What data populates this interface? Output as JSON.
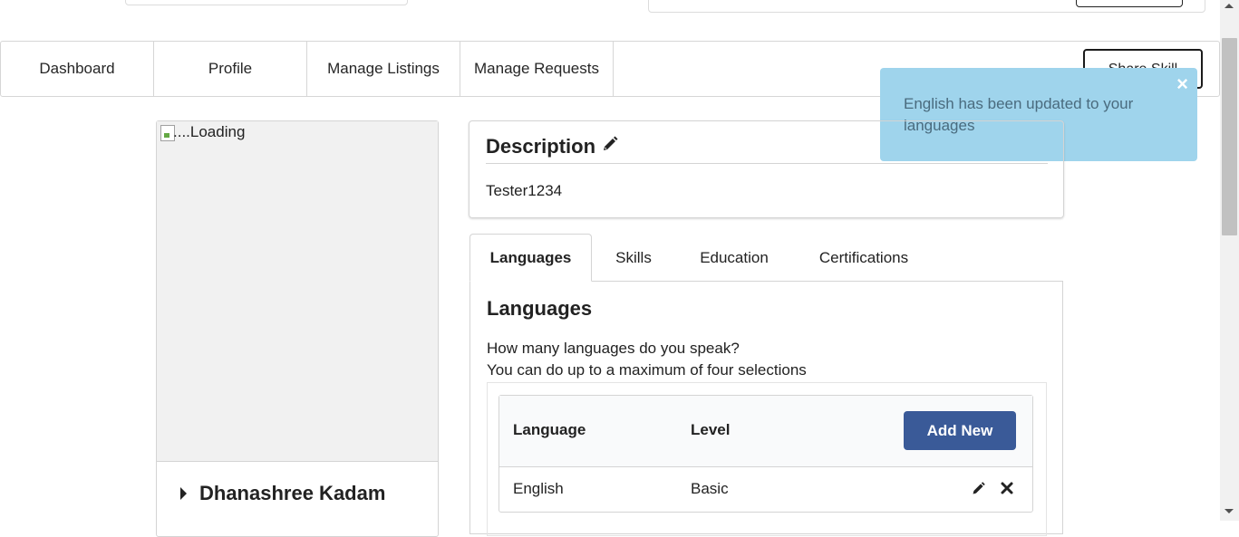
{
  "nav": {
    "items": [
      "Dashboard",
      "Profile",
      "Manage Listings",
      "Manage Requests"
    ],
    "share_label": "Share Skill"
  },
  "toast": {
    "message": "English has been updated to your languages",
    "close": "×"
  },
  "profile": {
    "image_alt": "....Loading",
    "name": "Dhanashree Kadam"
  },
  "description": {
    "title": "Description",
    "text": "Tester1234",
    "edit_icon": "pencil-icon"
  },
  "tabs": [
    "Languages",
    "Skills",
    "Education",
    "Certifications"
  ],
  "languages": {
    "title": "Languages",
    "help_line1": "How many languages do you speak?",
    "help_line2": "You can do up to a maximum of four selections",
    "columns": {
      "language": "Language",
      "level": "Level"
    },
    "add_label": "Add New",
    "rows": [
      {
        "language": "English",
        "level": "Basic"
      }
    ]
  },
  "colors": {
    "toast_bg": "#9fd4ec",
    "primary": "#3a5a98"
  }
}
